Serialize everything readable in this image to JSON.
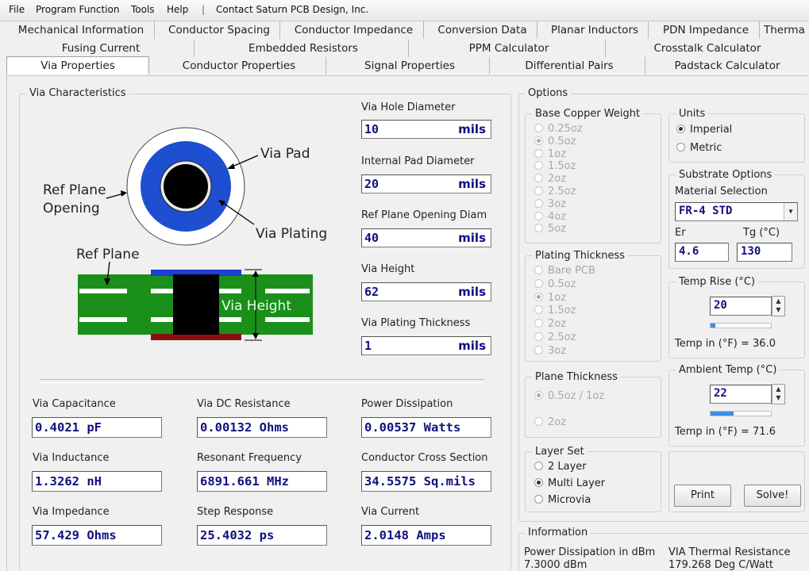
{
  "menu": {
    "items": [
      "File",
      "Program Function",
      "Tools",
      "Help",
      "|",
      "Contact Saturn PCB Design, Inc."
    ]
  },
  "tabs": {
    "row1": [
      "Mechanical Information",
      "Conductor Spacing",
      "Conductor Impedance",
      "Conversion Data",
      "Planar Inductors",
      "PDN  Impedance",
      "Therma"
    ],
    "row2": [
      "Fusing Current",
      "Embedded Resistors",
      "PPM Calculator",
      "Crosstalk Calculator"
    ],
    "row3": [
      "Via Properties",
      "Conductor Properties",
      "Signal Properties",
      "Differential Pairs",
      "Padstack Calculator"
    ],
    "selected": "Via Properties"
  },
  "via_characteristics": {
    "title": "Via Characteristics",
    "diagram": {
      "via_pad": "Via Pad",
      "ref_plane_opening_1": "Ref Plane",
      "ref_plane_opening_2": "Opening",
      "via_plating": "Via Plating",
      "ref_plane": "Ref Plane",
      "via_height": "Via Height",
      "colors": {
        "pad": "#1f4fd1",
        "hole": "#000000",
        "board": "#1a8f1a",
        "plane": "#ffffff",
        "top": "#1f3fd1",
        "bottom": "#8a1010"
      }
    },
    "inputs": [
      {
        "label": "Via Hole Diameter",
        "value": "10",
        "unit": "mils"
      },
      {
        "label": "Internal Pad Diameter",
        "value": "20",
        "unit": "mils"
      },
      {
        "label": "Ref Plane Opening Diam",
        "value": "40",
        "unit": "mils"
      },
      {
        "label": "Via Height",
        "value": "62",
        "unit": "mils"
      },
      {
        "label": "Via Plating Thickness",
        "value": "1",
        "unit": "mils"
      }
    ],
    "results": [
      {
        "label": "Via Capacitance",
        "value": "0.4021 pF"
      },
      {
        "label": "Via DC Resistance",
        "value": "0.00132 Ohms"
      },
      {
        "label": "Power Dissipation",
        "value": "0.00537 Watts"
      },
      {
        "label": "Via Inductance",
        "value": "1.3262 nH"
      },
      {
        "label": "Resonant Frequency",
        "value": "6891.661 MHz"
      },
      {
        "label": "Conductor Cross Section",
        "value": "34.5575 Sq.mils"
      },
      {
        "label": "Via Impedance",
        "value": "57.429 Ohms"
      },
      {
        "label": "Step Response",
        "value": "25.4032 ps"
      },
      {
        "label": "Via Current",
        "value": "2.0148 Amps"
      }
    ]
  },
  "options": {
    "title": "Options",
    "base_copper": {
      "title": "Base Copper Weight",
      "items": [
        "0.25oz",
        "0.5oz",
        "1oz",
        "1.5oz",
        "2oz",
        "2.5oz",
        "3oz",
        "4oz",
        "5oz"
      ],
      "selected": "0.5oz"
    },
    "plating": {
      "title": "Plating Thickness",
      "items": [
        "Bare PCB",
        "0.5oz",
        "1oz",
        "1.5oz",
        "2oz",
        "2.5oz",
        "3oz"
      ],
      "selected": "1oz"
    },
    "plane_thickness": {
      "title": "Plane Thickness",
      "items": [
        "0.5oz / 1oz",
        "2oz"
      ],
      "selected": "0.5oz / 1oz"
    },
    "layer_set": {
      "title": "Layer Set",
      "items": [
        "2 Layer",
        "Multi Layer",
        "Microvia"
      ],
      "selected": "Multi Layer"
    },
    "units": {
      "title": "Units",
      "items": [
        "Imperial",
        "Metric"
      ],
      "selected": "Imperial"
    },
    "substrate": {
      "title": "Substrate Options",
      "material_label": "Material Selection",
      "material_value": "FR-4 STD",
      "er_label": "Er",
      "er_value": "4.6",
      "tg_label": "Tg (°C)",
      "tg_value": "130"
    },
    "temp_rise": {
      "title": "Temp Rise (°C)",
      "value": "20",
      "slider_fraction": 0.08,
      "footer": "Temp in (°F) = 36.0"
    },
    "ambient_temp": {
      "title": "Ambient Temp (°C)",
      "value": "22",
      "slider_fraction": 0.38,
      "footer": "Temp in (°F) = 71.6"
    },
    "buttons": {
      "print": "Print",
      "solve": "Solve!"
    }
  },
  "information": {
    "title": "Information",
    "power_label": "Power Dissipation in dBm",
    "power_value": "7.3000 dBm",
    "thermal_label": "VIA Thermal Resistance",
    "thermal_value": "179.268 Deg C/Watt"
  }
}
